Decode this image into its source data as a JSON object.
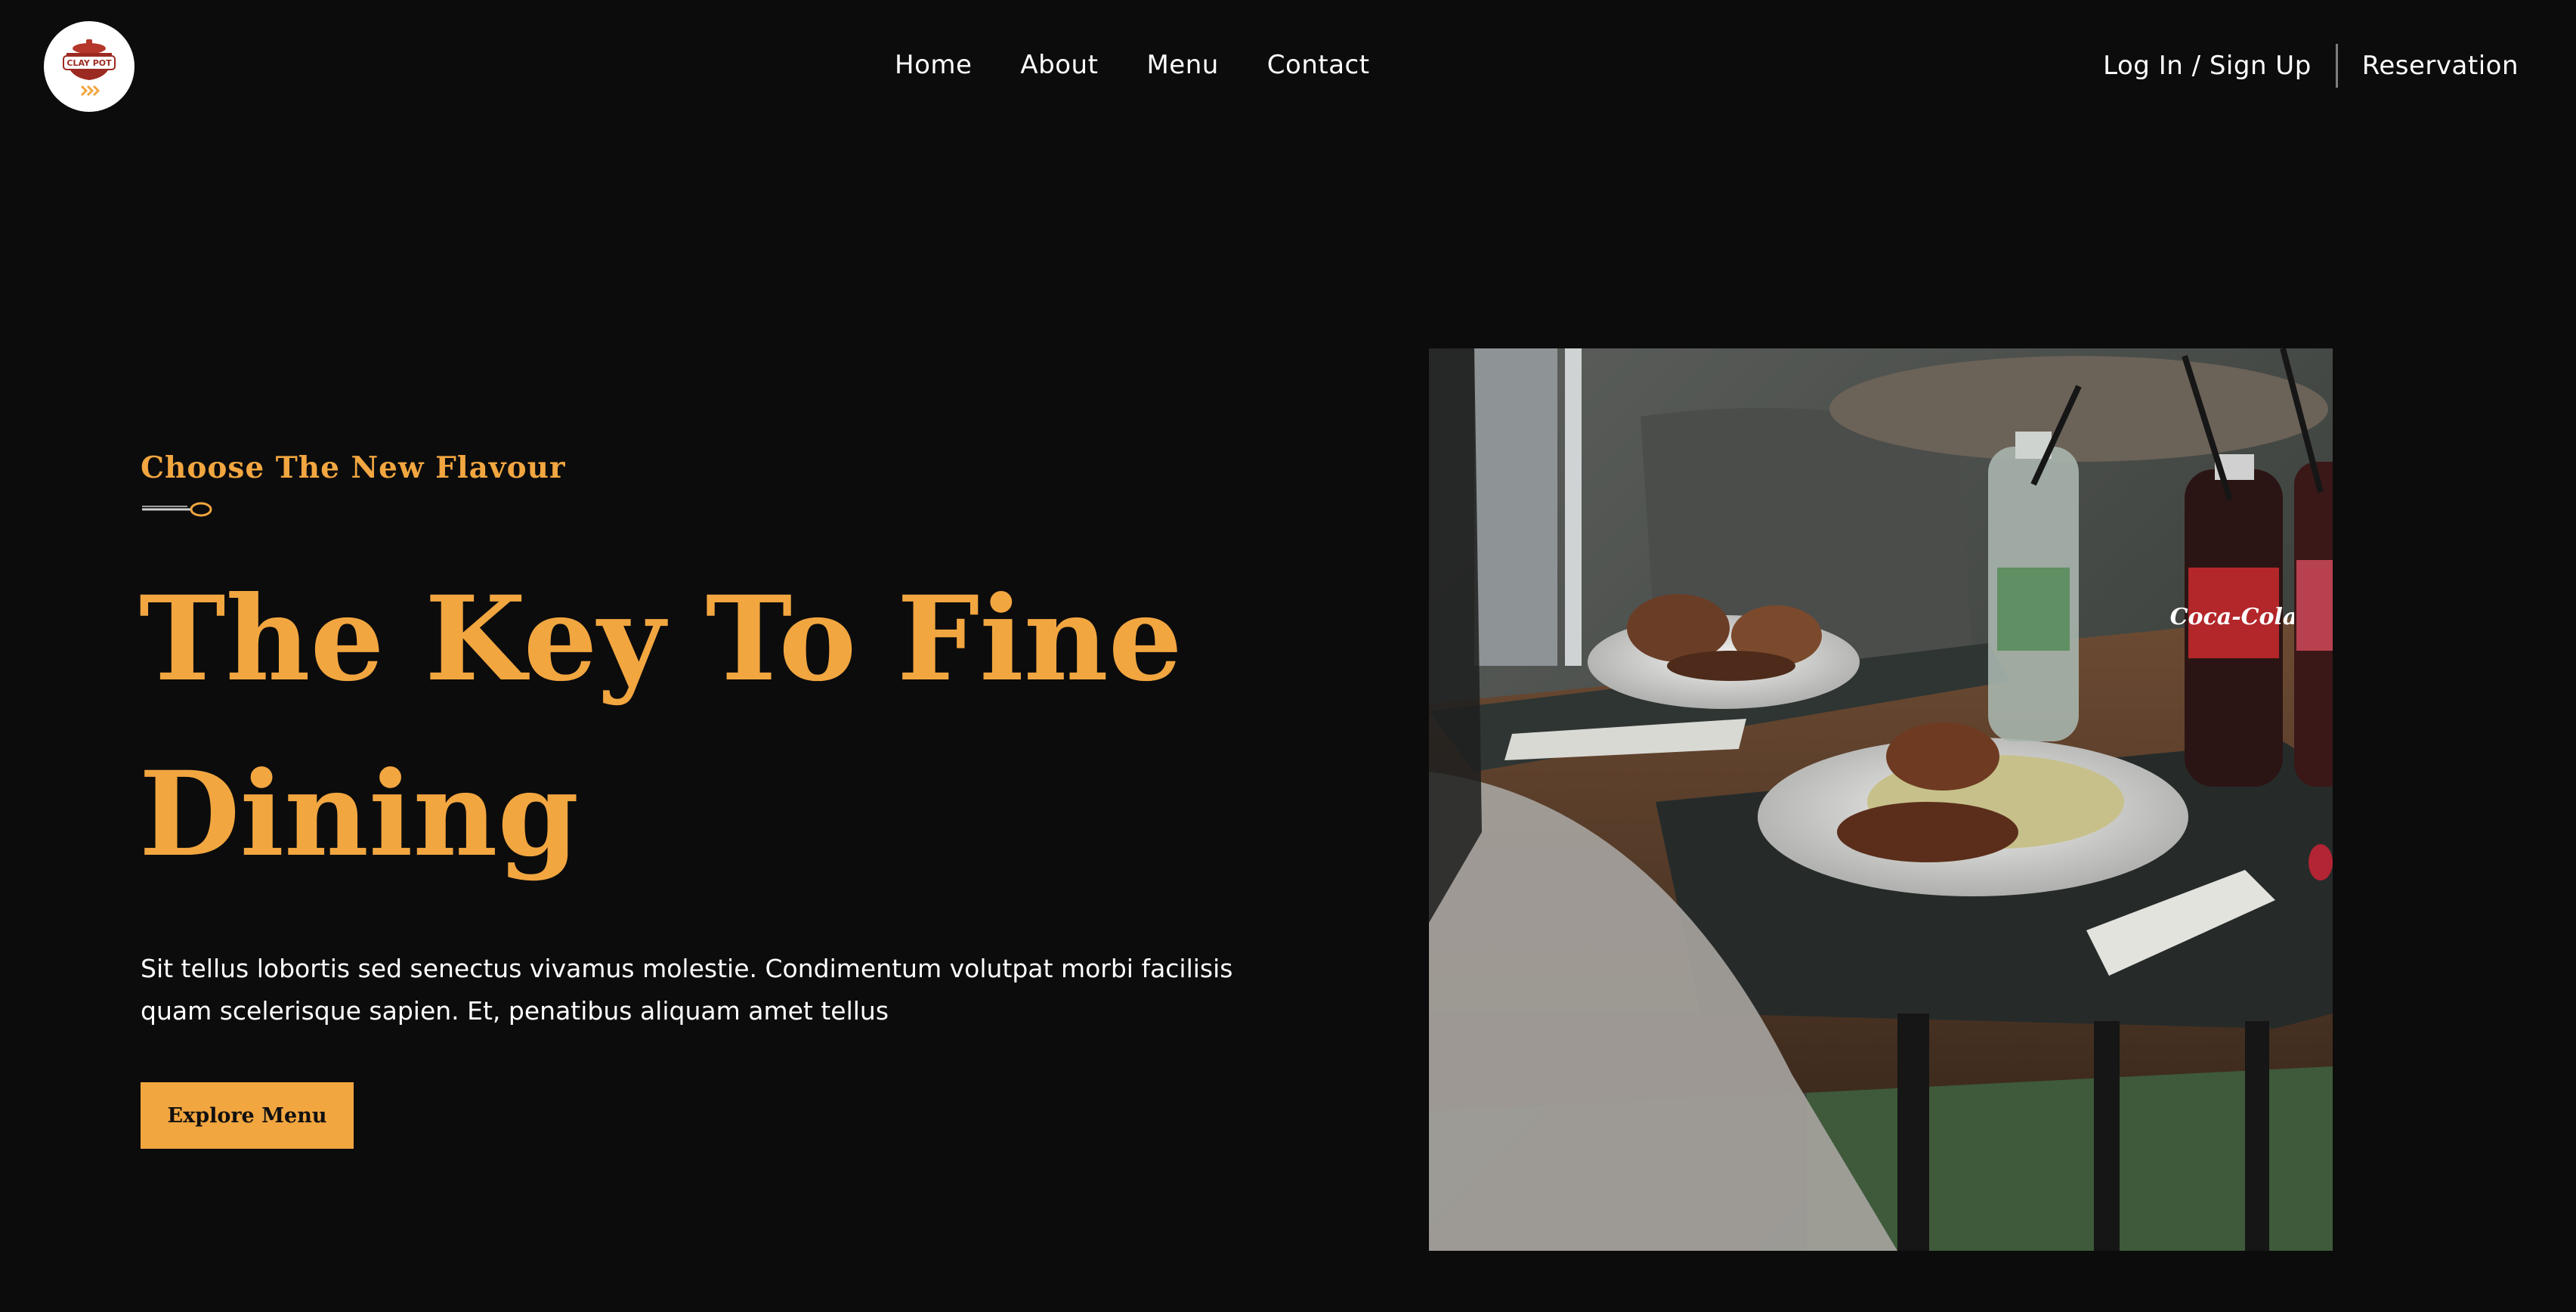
{
  "brand": {
    "logo_text": "CLAY POT"
  },
  "nav": {
    "items": [
      {
        "label": "Home"
      },
      {
        "label": "About"
      },
      {
        "label": "Menu"
      },
      {
        "label": "Contact"
      }
    ]
  },
  "header_actions": {
    "login_label": "Log In / Sign Up",
    "reservation_label": "Reservation"
  },
  "hero": {
    "eyebrow": "Choose The New Flavour",
    "headline": "The Key To Fine Dining",
    "description": "Sit tellus lobortis sed senectus vivamus molestie. Condimentum volutpat morbi facilisis quam scelerisque sapien. Et, penatibus aliquam amet tellus",
    "cta_label": "Explore Menu"
  },
  "colors": {
    "background": "#0c0c0c",
    "accent": "#f2a640",
    "text": "#ffffff"
  },
  "icons": {
    "logo": "clay-pot-logo",
    "divider_icon": "spoon-icon"
  }
}
